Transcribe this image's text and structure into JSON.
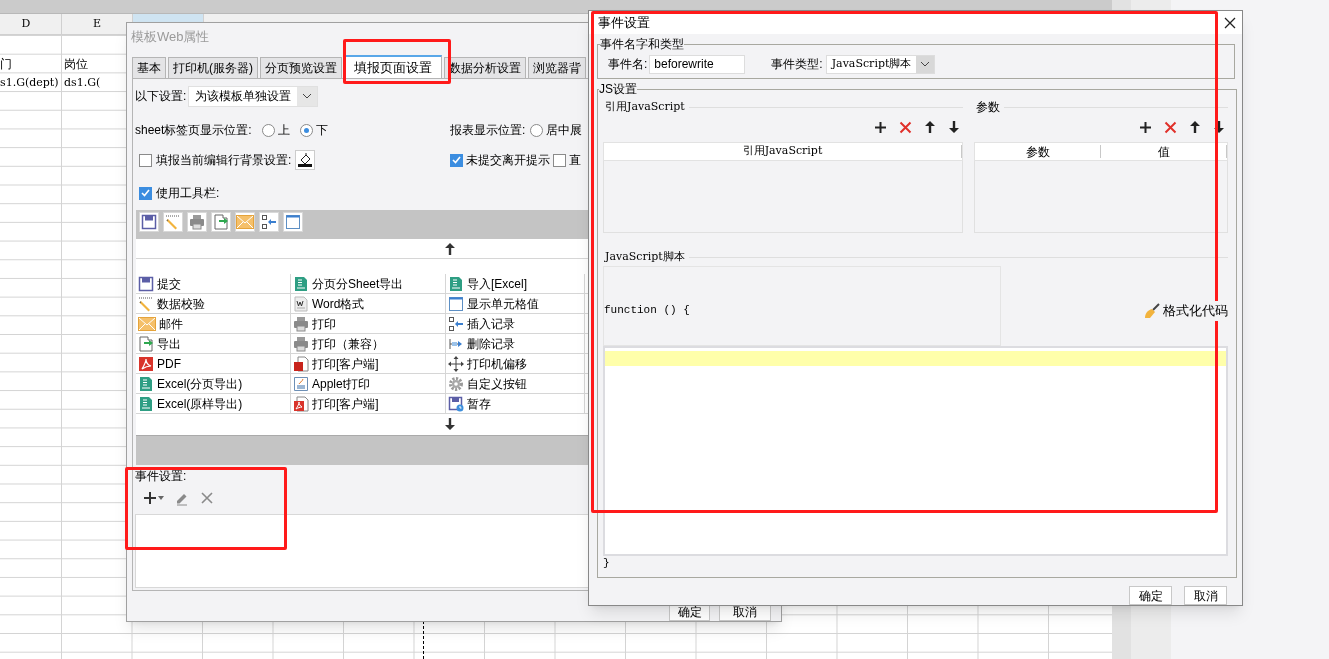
{
  "spreadsheet": {
    "column_headers": [
      "D",
      "E"
    ],
    "rows": [
      [
        "门",
        "岗位"
      ],
      [
        "s1.G(dept)",
        "ds1.G("
      ]
    ]
  },
  "web_dialog": {
    "title": "模板Web属性",
    "tabs": [
      {
        "label": "基本",
        "selected": false
      },
      {
        "label": "打印机(服务器)",
        "selected": false
      },
      {
        "label": "分页预览设置",
        "selected": false
      },
      {
        "label": "填报页面设置",
        "selected": true
      },
      {
        "label": "数据分析设置",
        "selected": false
      },
      {
        "label": "浏览器背",
        "selected": false
      }
    ],
    "scope": {
      "label": "以下设置:",
      "value": "为该模板单独设置"
    },
    "sheet_tab_position": {
      "label": "sheet标签页显示位置:",
      "options": [
        {
          "label": "上",
          "selected": false
        },
        {
          "label": "下",
          "selected": true
        }
      ]
    },
    "report_position": {
      "label": "报表显示位置:",
      "options": [
        {
          "label": "居中展",
          "selected": false
        }
      ]
    },
    "edit_row_background": {
      "label": "填报当前编辑行背景设置:",
      "checked": false
    },
    "leave_prompt": {
      "label": "未提交离开提示",
      "checked": true
    },
    "cut_option": {
      "label": "直",
      "checked": false
    },
    "use_toolbar": {
      "label": "使用工具栏:",
      "checked": true
    },
    "toolbar_items": [
      [
        "提交",
        "分页分Sheet导出",
        "导入[Excel]"
      ],
      [
        "数据校验",
        "Word格式",
        "显示单元格值"
      ],
      [
        "邮件",
        "打印",
        "插入记录"
      ],
      [
        "导出",
        "打印（兼容）",
        "删除记录"
      ],
      [
        "PDF",
        "打印[客户端]",
        "打印机偏移"
      ],
      [
        "Excel(分页导出)",
        "Applet打印",
        "自定义按钮"
      ],
      [
        "Excel(原样导出)",
        "打印[客户端]",
        "暂存"
      ]
    ],
    "event_settings": {
      "label": "事件设置:"
    },
    "buttons": [
      "确定",
      "取消"
    ]
  },
  "event_dialog": {
    "title": "事件设置",
    "name_group": {
      "legend": "事件名字和类型",
      "name_label": "事件名:",
      "name_value": "beforewrite",
      "type_label": "事件类型:",
      "type_value": "JavaScript脚本"
    },
    "js_group": {
      "legend": "JS设置",
      "references": {
        "heading": "引用JavaScript",
        "columns": [
          "引用JavaScript"
        ]
      },
      "parameters": {
        "heading": "参数",
        "columns": [
          "参数",
          "值"
        ]
      },
      "script": {
        "heading": "JavaScript脚本",
        "code_start": "function () {",
        "code_end": "}",
        "format_button": "格式化代码"
      }
    },
    "buttons": [
      "确定",
      "取消"
    ]
  }
}
